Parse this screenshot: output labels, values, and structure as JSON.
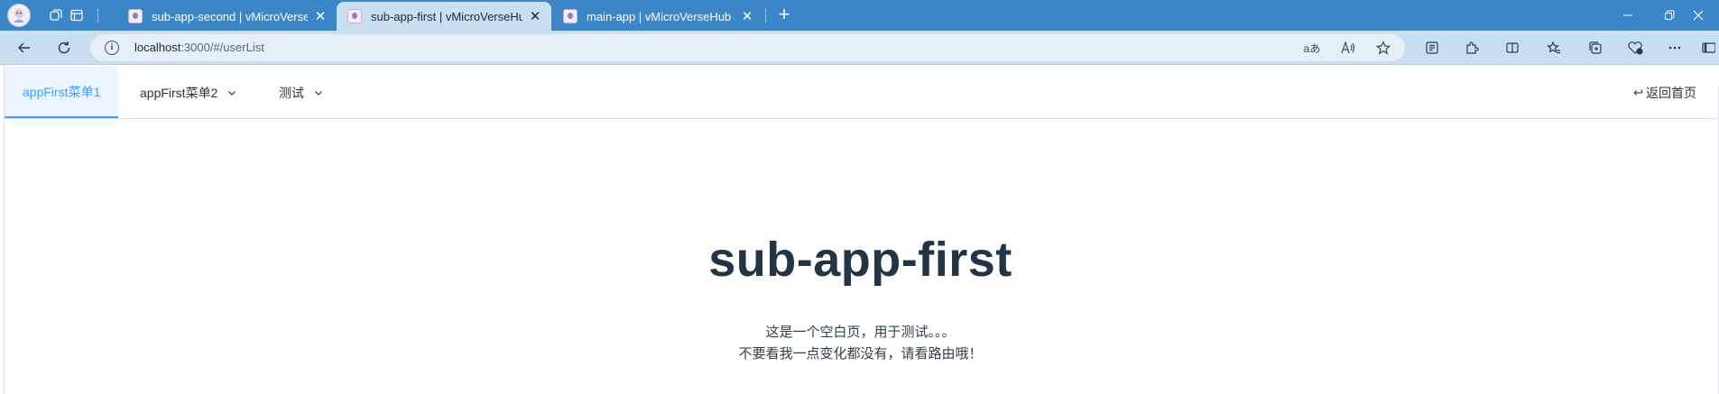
{
  "browser": {
    "tabs": [
      {
        "title": "sub-app-second | vMicroVerseHub",
        "active": false
      },
      {
        "title": "sub-app-first | vMicroVerseHub",
        "active": true
      },
      {
        "title": "main-app | vMicroVerseHub",
        "active": false
      }
    ],
    "tab_close_glyph": "✕",
    "new_tab_glyph": "+",
    "address": {
      "host": "localhost",
      "rest": ":3000/#/userList"
    },
    "read_aloud_label": "aあ",
    "accent_color": "#3a86c8"
  },
  "app": {
    "menu": [
      {
        "label": "appFirst菜单1",
        "active": true,
        "has_dropdown": false
      },
      {
        "label": "appFirst菜单2",
        "active": false,
        "has_dropdown": true
      },
      {
        "label": "测试",
        "active": false,
        "has_dropdown": true
      }
    ],
    "back_label": "返回首页",
    "back_arrow": "↩",
    "title": "sub-app-first",
    "description_line1": "这是一个空白页，用于测试。。。",
    "description_line2": "不要看我一点变化都没有，请看路由哦！",
    "active_color": "#409eff"
  }
}
